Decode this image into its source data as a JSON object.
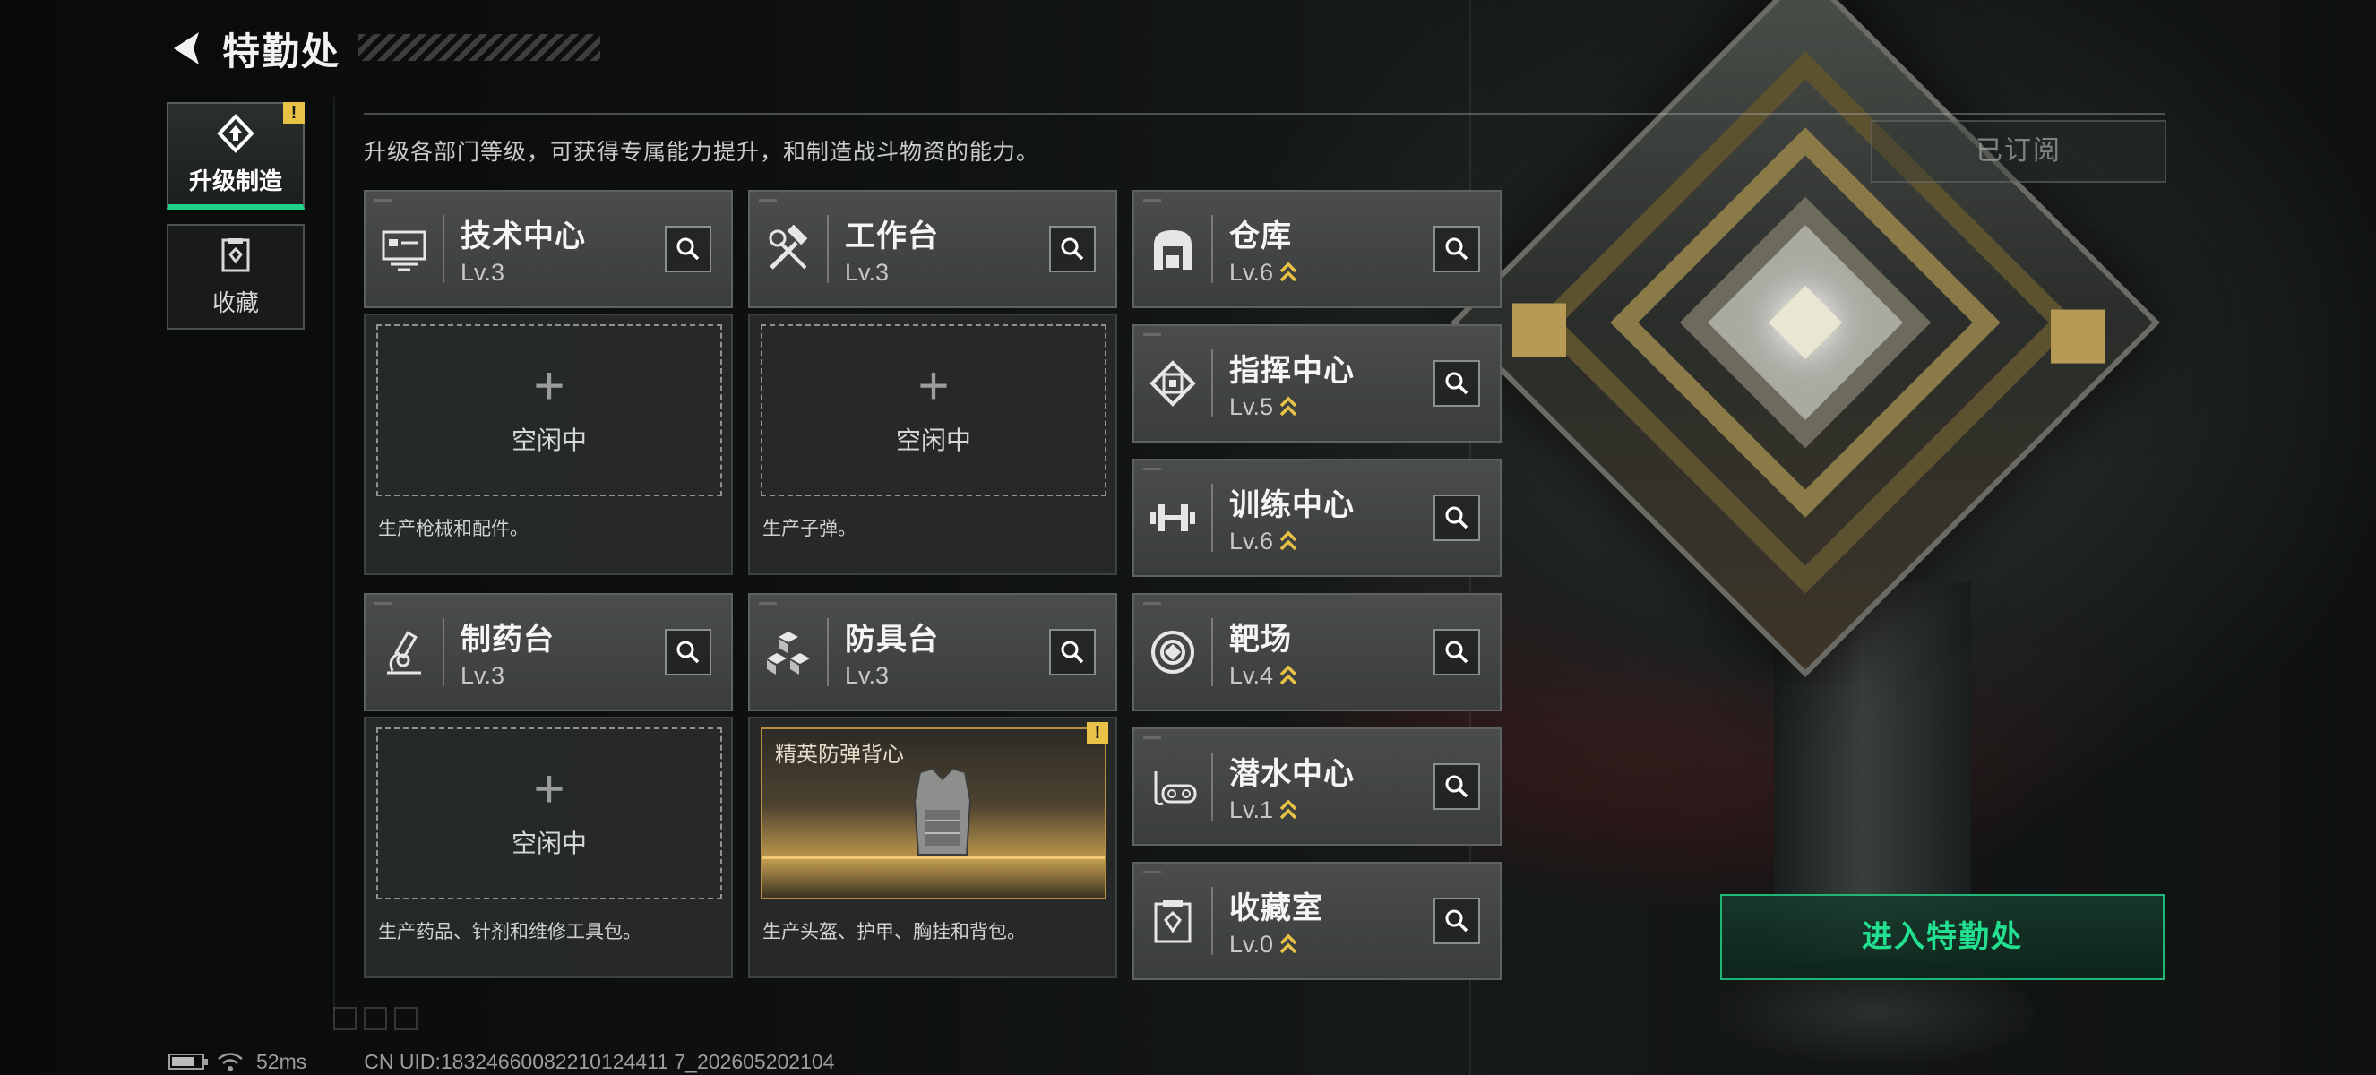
{
  "header": {
    "title": "特勤处"
  },
  "tabs": [
    {
      "label": "升级制造",
      "active": true,
      "alert": "!"
    },
    {
      "label": "收藏",
      "active": false
    }
  ],
  "description": "升级各部门等级，可获得专属能力提升，和制造战斗物资的能力。",
  "subscribed_label": "已订阅",
  "production": [
    {
      "name": "技术中心",
      "level": "Lv.3",
      "icon": "tech-center-icon",
      "slot_label": "空闲中",
      "desc": "生产枪械和配件。"
    },
    {
      "name": "工作台",
      "level": "Lv.3",
      "icon": "workbench-icon",
      "slot_label": "空闲中",
      "desc": "生产子弹。"
    },
    {
      "name": "制药台",
      "level": "Lv.3",
      "icon": "pharmacy-icon",
      "slot_label": "空闲中",
      "desc": "生产药品、针剂和维修工具包。"
    },
    {
      "name": "防具台",
      "level": "Lv.3",
      "icon": "armor-bench-icon",
      "busy_item": "精英防弹背心",
      "alert": "!",
      "desc": "生产头盔、护甲、胸挂和背包。"
    }
  ],
  "facilities": [
    {
      "name": "仓库",
      "level": "Lv.6",
      "icon": "warehouse-icon",
      "upgradable": true
    },
    {
      "name": "指挥中心",
      "level": "Lv.5",
      "icon": "command-center-icon",
      "upgradable": true
    },
    {
      "name": "训练中心",
      "level": "Lv.6",
      "icon": "training-center-icon",
      "upgradable": true
    },
    {
      "name": "靶场",
      "level": "Lv.4",
      "icon": "shooting-range-icon",
      "upgradable": true
    },
    {
      "name": "潜水中心",
      "level": "Lv.1",
      "icon": "diving-center-icon",
      "upgradable": true
    },
    {
      "name": "收藏室",
      "level": "Lv.0",
      "icon": "collection-room-icon",
      "upgradable": true
    }
  ],
  "enter_button": "进入特勤处",
  "status": {
    "ping": "52ms",
    "uid": "CN UID:18324660082210124411 7_202605202104",
    "battery_level": 0.75
  },
  "colors": {
    "accent": "#1fd18a",
    "alert": "#e8c247",
    "upgrade": "#e8c247"
  }
}
